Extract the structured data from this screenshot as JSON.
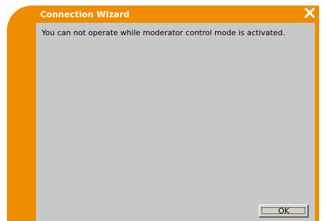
{
  "window": {
    "title": "Connection Wizard",
    "accent_color": "#ef8c00"
  },
  "close_icon": "close-icon",
  "message": "You can not operate while moderator control mode is activated.",
  "buttons": {
    "ok_label": "OK"
  }
}
